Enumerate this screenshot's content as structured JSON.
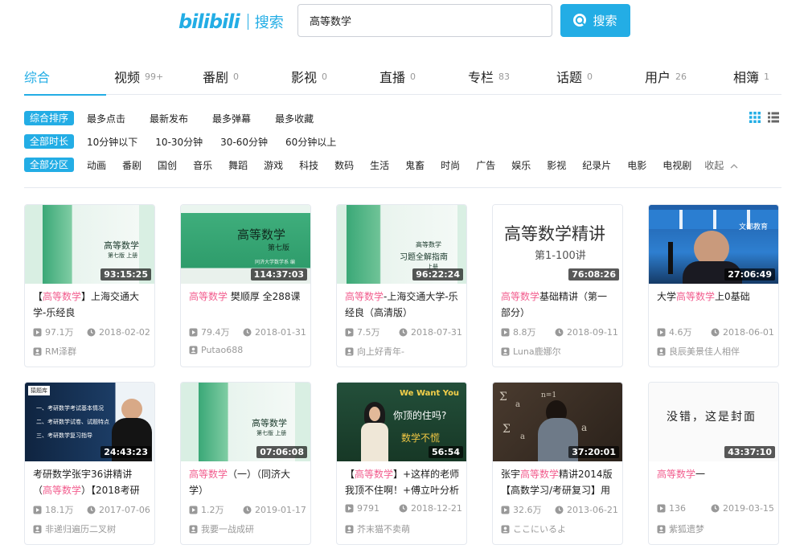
{
  "header": {
    "logo": "bilibili",
    "logo_sub": "搜索",
    "search_value": "高等数学",
    "search_button": "搜索"
  },
  "tabs": [
    {
      "label": "综合",
      "count": "",
      "active": true
    },
    {
      "label": "视频",
      "count": "99+"
    },
    {
      "label": "番剧",
      "count": "0"
    },
    {
      "label": "影视",
      "count": "0"
    },
    {
      "label": "直播",
      "count": "0"
    },
    {
      "label": "专栏",
      "count": "83"
    },
    {
      "label": "话题",
      "count": "0"
    },
    {
      "label": "用户",
      "count": "26"
    },
    {
      "label": "相簿",
      "count": "1"
    }
  ],
  "filters": {
    "sort": {
      "label": "综合排序",
      "options": [
        "最多点击",
        "最新发布",
        "最多弹幕",
        "最多收藏"
      ]
    },
    "duration": {
      "label": "全部时长",
      "options": [
        "10分钟以下",
        "10-30分钟",
        "30-60分钟",
        "60分钟以上"
      ]
    },
    "zone": {
      "label": "全部分区",
      "options": [
        "动画",
        "番剧",
        "国创",
        "音乐",
        "舞蹈",
        "游戏",
        "科技",
        "数码",
        "生活",
        "鬼畜",
        "时尚",
        "广告",
        "娱乐",
        "影视",
        "纪录片",
        "电影",
        "电视剧"
      ],
      "collapse": "收起"
    }
  },
  "colors": {
    "accent": "#23ade5",
    "highlight": "#f25d8e",
    "meta": "#999999"
  },
  "videos": [
    {
      "duration": "93:15:25",
      "title_pre": "【",
      "title_hl": "高等数学",
      "title_post": "】上海交通大学-乐经良",
      "views": "97.1万",
      "date": "2018-02-02",
      "uploader": "RM泽群"
    },
    {
      "duration": "114:37:03",
      "title_pre": "",
      "title_hl": "高等数学",
      "title_post": " 樊顺厚 全288课",
      "views": "79.4万",
      "date": "2018-01-31",
      "uploader": "Putao688"
    },
    {
      "duration": "96:22:24",
      "title_pre": "",
      "title_hl": "高等数学",
      "title_post": "-上海交通大学-乐经良（高清版）",
      "views": "7.5万",
      "date": "2018-07-31",
      "uploader": "向上好青年-"
    },
    {
      "duration": "76:08:26",
      "title_pre": "",
      "title_hl": "高等数学",
      "title_post": "基础精讲（第一部分）",
      "views": "8.8万",
      "date": "2018-09-11",
      "uploader": "Luna鹿娜尔"
    },
    {
      "duration": "27:06:49",
      "title_pre": "大学",
      "title_hl": "高等数学",
      "title_post": "上0基础",
      "views": "4.6万",
      "date": "2018-06-01",
      "uploader": "良辰美景佳人相伴"
    },
    {
      "duration": "24:43:23",
      "title_pre": "考研数学张宇36讲精讲（",
      "title_hl": "高等数学",
      "title_post": "）【2018考研资料】",
      "views": "18.1万",
      "date": "2017-07-06",
      "uploader": "非递归遍历二叉树"
    },
    {
      "duration": "07:06:08",
      "title_pre": "",
      "title_hl": "高等数学",
      "title_post": "（一）（同济大学）",
      "views": "1.2万",
      "date": "2019-01-17",
      "uploader": "我要一战成研"
    },
    {
      "duration": "56:54",
      "title_pre": "【",
      "title_hl": "高等数学",
      "title_post": "】+这样的老师我顶不住啊！+傅立叶分析",
      "views": "9791",
      "date": "2018-12-21",
      "uploader": "芥末猫不卖萌"
    },
    {
      "duration": "37:20:01",
      "title_pre": "张宇",
      "title_hl": "高等数学",
      "title_post": "精讲2014版【高数学习/考研复习】用",
      "views": "32.6万",
      "date": "2013-06-21",
      "uploader": "ここにいるよ"
    },
    {
      "duration": "43:37:10",
      "title_pre": "",
      "title_hl": "高等数学",
      "title_post": "一",
      "views": "136",
      "date": "2019-03-15",
      "uploader": "紫狐遗梦"
    }
  ],
  "thumb_text": {
    "book1": "高等数学",
    "book1_sub": "第七版 上册",
    "book2": "高等数学",
    "book2_sub": "第七版",
    "book2_pub": "同济大学数学系 编",
    "book3": "高等数学",
    "book3_sub": "习题全解指南",
    "book3_sub2": "上册",
    "card4_title": "高等数学精讲",
    "card4_sub": "第1-100讲",
    "card5_logo": "文都教育",
    "card6_logo": "猿题库",
    "card6_items": [
      "一、考研数学考试基本情况",
      "二、考研数学试卷、试题特点",
      "三、考研数学复习指导"
    ],
    "card8_top": "We Want You",
    "card8_mid": "你顶的住吗?",
    "card8_bot": "数学不慌",
    "card10_text": "没错，这是封面"
  }
}
